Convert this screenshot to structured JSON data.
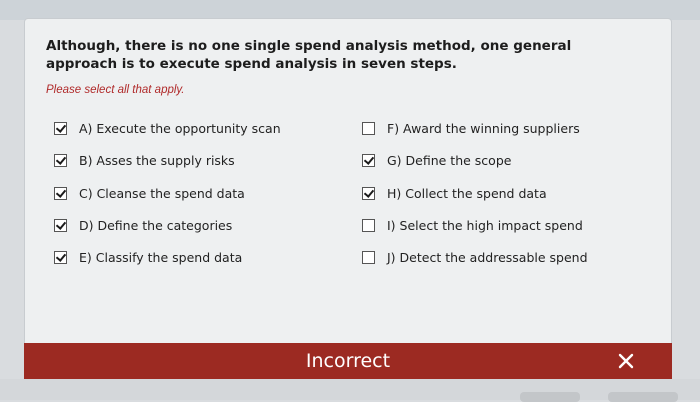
{
  "question": {
    "text": "Although, there is no one single spend analysis method, one general approach is to execute spend analysis in seven steps.",
    "instruction": "Please select all that apply."
  },
  "options": [
    {
      "label": "A) Execute the opportunity scan",
      "checked": true
    },
    {
      "label": "B) Asses the supply risks",
      "checked": true
    },
    {
      "label": "C) Cleanse the spend data",
      "checked": true
    },
    {
      "label": "D) Define the categories",
      "checked": true
    },
    {
      "label": "E) Classify the spend data",
      "checked": true
    },
    {
      "label": "F) Award the winning suppliers",
      "checked": false
    },
    {
      "label": "G) Define the scope",
      "checked": true
    },
    {
      "label": "H) Collect the spend data",
      "checked": true
    },
    {
      "label": "I) Select the high impact spend",
      "checked": false
    },
    {
      "label": "J) Detect the addressable spend",
      "checked": false
    }
  ],
  "feedback": {
    "title": "Incorrect",
    "close_icon": "close-icon"
  },
  "colors": {
    "banner": "#9c2a22",
    "instruction": "#b02a2a",
    "card": "#eef0f1"
  }
}
